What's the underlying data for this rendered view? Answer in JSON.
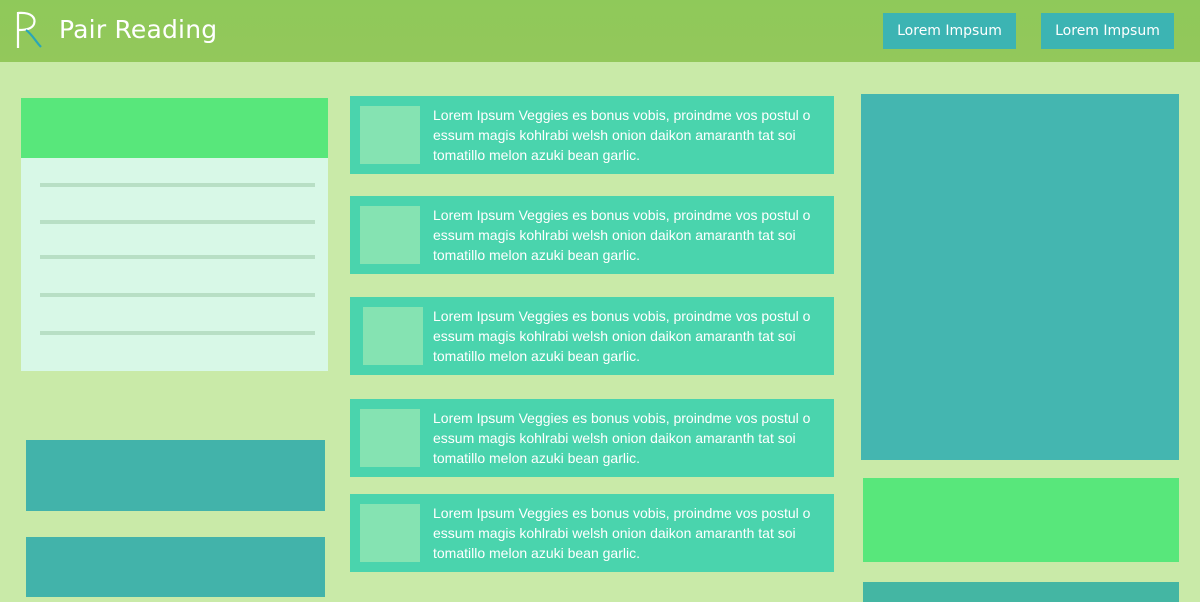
{
  "header": {
    "app_title": "Pair Reading",
    "logo_letter": "R",
    "nav_buttons": [
      {
        "label": "Lorem Impsum"
      },
      {
        "label": "Lorem Impsum"
      }
    ]
  },
  "feed": {
    "items": [
      {
        "text": "Lorem Ipsum Veggies es bonus vobis, proindme vos postul o essum magis kohlrabi welsh onion daikon amaranth tat soi tomatillo melon azuki bean garlic."
      },
      {
        "text": "Lorem Ipsum Veggies es bonus vobis, proindme vos postul o essum magis kohlrabi welsh onion daikon amaranth tat soi tomatillo melon azuki bean garlic."
      },
      {
        "text": "Lorem Ipsum Veggies es bonus vobis, proindme vos postul o essum magis kohlrabi welsh onion daikon amaranth tat soi tomatillo melon azuki bean garlic."
      },
      {
        "text": "Lorem Ipsum Veggies es bonus vobis, proindme vos postul o essum magis kohlrabi welsh onion daikon amaranth tat soi tomatillo melon azuki bean garlic."
      },
      {
        "text": "Lorem Ipsum Veggies es bonus vobis, proindme vos postul o essum magis kohlrabi welsh onion daikon amaranth tat soi tomatillo melon azuki bean garlic."
      }
    ]
  },
  "colors": {
    "background": "#c9eaa8",
    "header": "#8fc95a",
    "nav_button": "#3cb4b3",
    "accent_green": "#58e77b",
    "teal": "#44b6b0",
    "feed_item": "#4ad4ad"
  },
  "icons": {
    "logo": "r-logo-icon"
  }
}
